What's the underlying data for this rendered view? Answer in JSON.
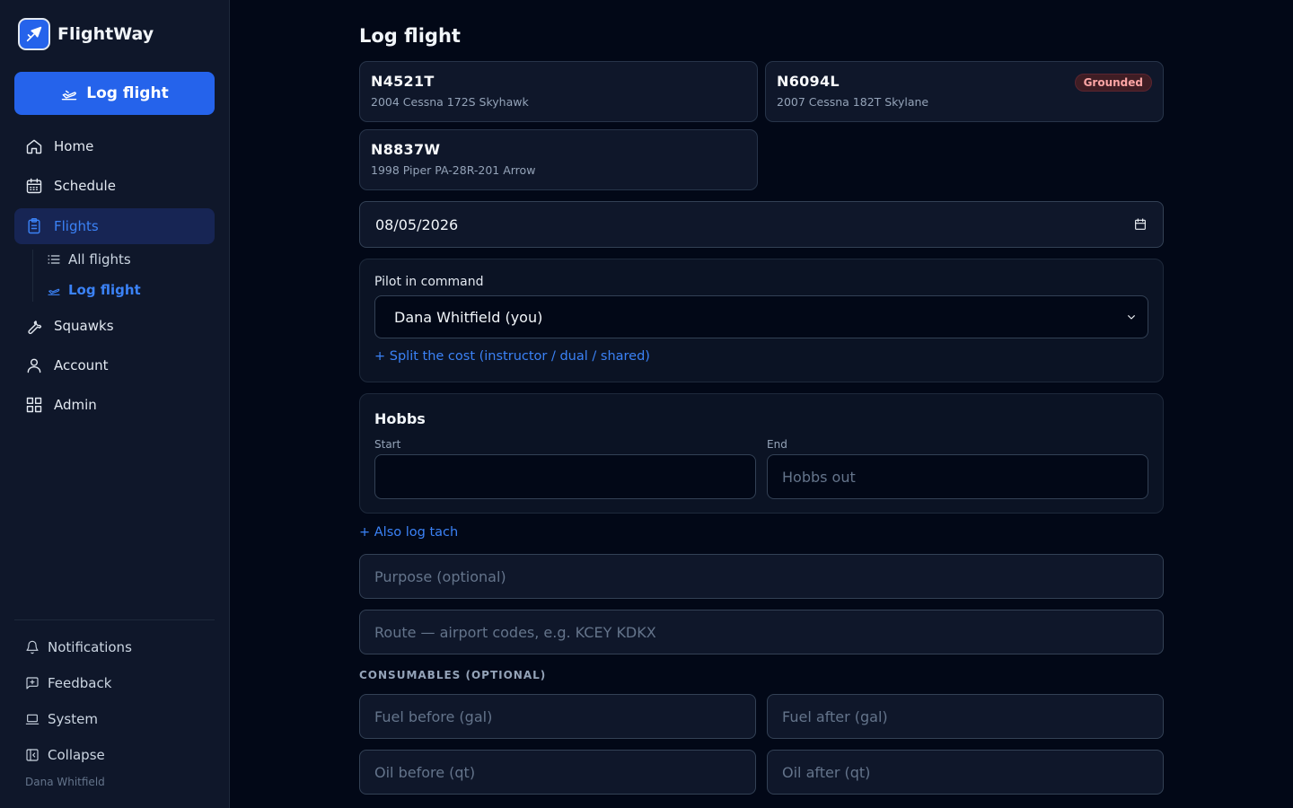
{
  "brand": {
    "name": "FlightWay"
  },
  "sidebar": {
    "primary_action": "Log flight",
    "nav": [
      {
        "label": "Home",
        "icon": "home-icon"
      },
      {
        "label": "Schedule",
        "icon": "calendar-icon"
      },
      {
        "label": "Flights",
        "icon": "clipboard-icon"
      },
      {
        "label": "Squawks",
        "icon": "wrench-icon"
      },
      {
        "label": "Account",
        "icon": "user-icon"
      },
      {
        "label": "Admin",
        "icon": "grid-icon"
      }
    ],
    "flights_sub": [
      {
        "label": "All flights",
        "icon": "list-icon"
      },
      {
        "label": "Log flight",
        "icon": "plane-takeoff-icon"
      }
    ],
    "footer": [
      {
        "label": "Notifications",
        "icon": "bell-icon"
      },
      {
        "label": "Feedback",
        "icon": "message-plus-icon"
      },
      {
        "label": "System",
        "icon": "laptop-icon"
      },
      {
        "label": "Collapse",
        "icon": "sidebar-collapse-icon"
      }
    ],
    "user_name": "Dana Whitfield"
  },
  "main": {
    "title": "Log flight",
    "aircraft": [
      {
        "tail": "N4521T",
        "model": "2004 Cessna 172S Skyhawk",
        "badge": ""
      },
      {
        "tail": "N6094L",
        "model": "2007 Cessna 182T Skylane",
        "badge": "Grounded"
      },
      {
        "tail": "N8837W",
        "model": "1998 Piper PA-28R-201 Arrow",
        "badge": ""
      }
    ],
    "date_value": "08/05/2026",
    "pic": {
      "label": "Pilot in command",
      "selected": "Dana Whitfield (you)",
      "split_link": "+ Split the cost (instructor / dual / shared)"
    },
    "hobbs": {
      "title": "Hobbs",
      "start_label": "Start",
      "start_value": "",
      "end_label": "End",
      "end_placeholder": "Hobbs out"
    },
    "tach_link": "+ Also log tach",
    "purpose_placeholder": "Purpose (optional)",
    "route_placeholder": "Route — airport codes, e.g. KCEY KDKX",
    "consumables": {
      "heading": "CONSUMABLES (OPTIONAL)",
      "fuel_before": "Fuel before (gal)",
      "fuel_after": "Fuel after (gal)",
      "oil_before": "Oil before (qt)",
      "oil_after": "Oil after (qt)"
    }
  },
  "colors": {
    "accent": "#2563eb",
    "link": "#3b82f6",
    "background": "#020817",
    "sidebar": "#0f172a",
    "danger_text": "#fca5a5"
  }
}
